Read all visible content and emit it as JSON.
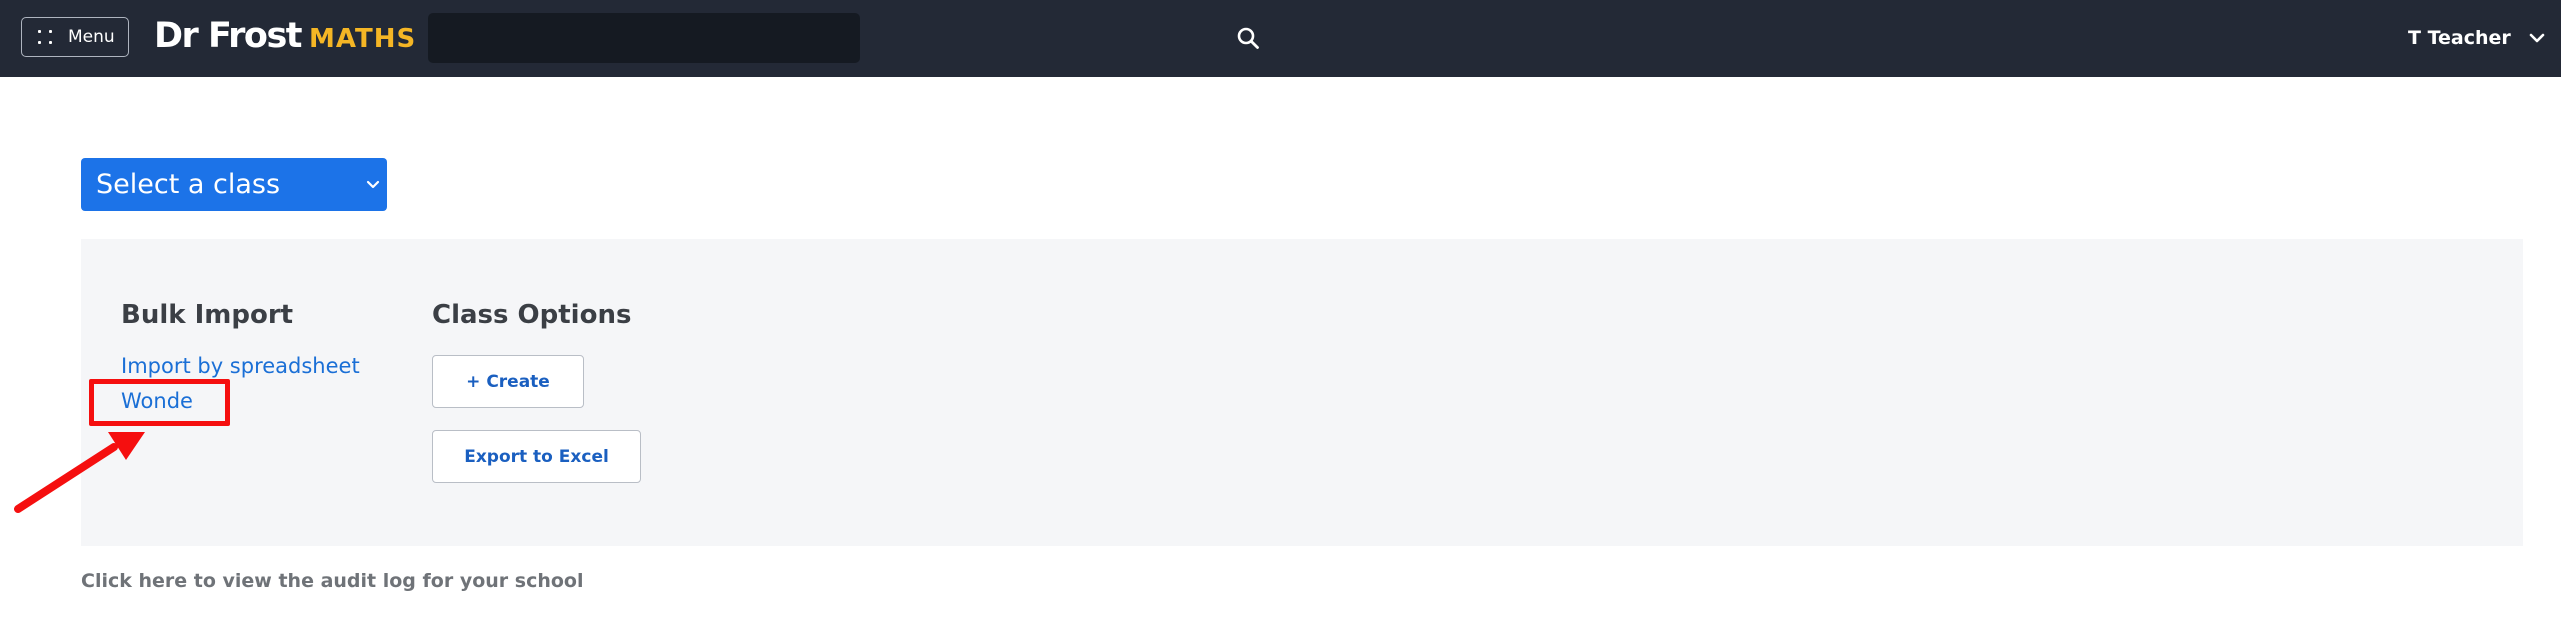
{
  "navbar": {
    "menu_label": "Menu",
    "logo_primary": "Dr Frost",
    "logo_secondary": "MATHS",
    "search_value": "",
    "user_name": "T Teacher"
  },
  "class_select": {
    "selected": "Select a class"
  },
  "bulk_import": {
    "title": "Bulk Import",
    "links": [
      "Import by spreadsheet",
      "Wonde"
    ]
  },
  "class_options": {
    "title": "Class Options",
    "create_label": "+ Create",
    "export_label": "Export to Excel"
  },
  "footer": {
    "audit_log_link": "Click here to view the audit log for your school"
  },
  "colors": {
    "navbar_bg": "#232936",
    "brand_yellow": "#f5b625",
    "primary_blue": "#1c73e8",
    "link_blue": "#1a6fd6",
    "panel_bg": "#f5f6f8",
    "annotation_red": "#f50f0f"
  },
  "icons": {
    "menu": "grid-dots-icon",
    "search": "search-icon",
    "user_dropdown": "chevron-down-icon",
    "select_dropdown": "chevron-down-icon",
    "annotation": "arrow-icon"
  }
}
